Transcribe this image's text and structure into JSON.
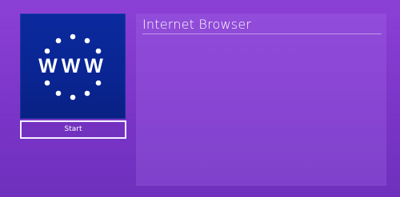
{
  "app": {
    "title": "Internet Browser",
    "tile_text": "WWW",
    "tile_icon": "globe-www-icon",
    "start_label": "Start"
  },
  "colors": {
    "background": "#7a34c8",
    "tile": "#0a2592",
    "panel": "#9c5fe0",
    "text": "#ffffff"
  }
}
